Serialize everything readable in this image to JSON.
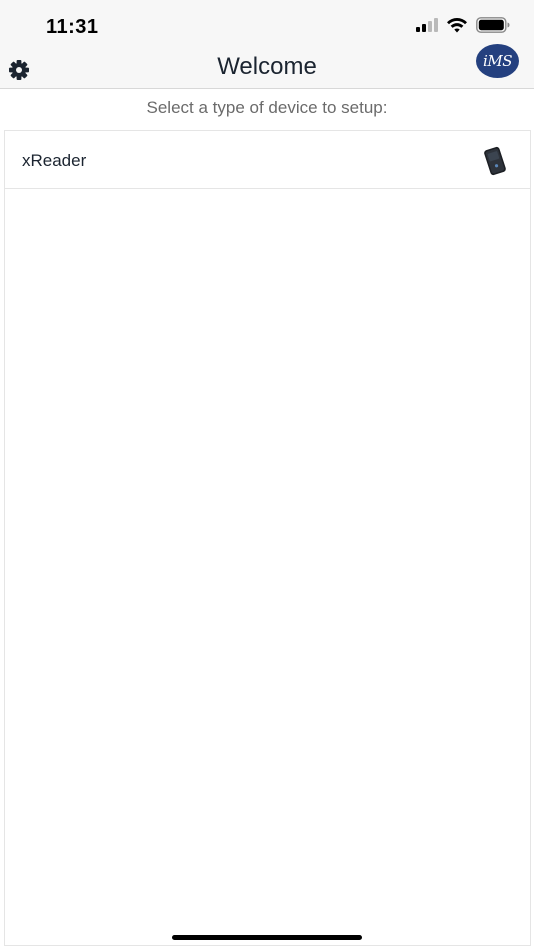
{
  "status_bar": {
    "time": "11:31"
  },
  "nav": {
    "title": "Welcome",
    "logo_text": "iMS"
  },
  "content": {
    "subtitle": "Select a type of device to setup:",
    "devices": [
      {
        "label": "xReader",
        "icon": "xreader-device-icon"
      }
    ]
  },
  "colors": {
    "nav_background": "#f7f7f7",
    "logo_background": "#24407f",
    "title_text": "#1b2430",
    "subtitle_text": "#6b6b6b"
  }
}
